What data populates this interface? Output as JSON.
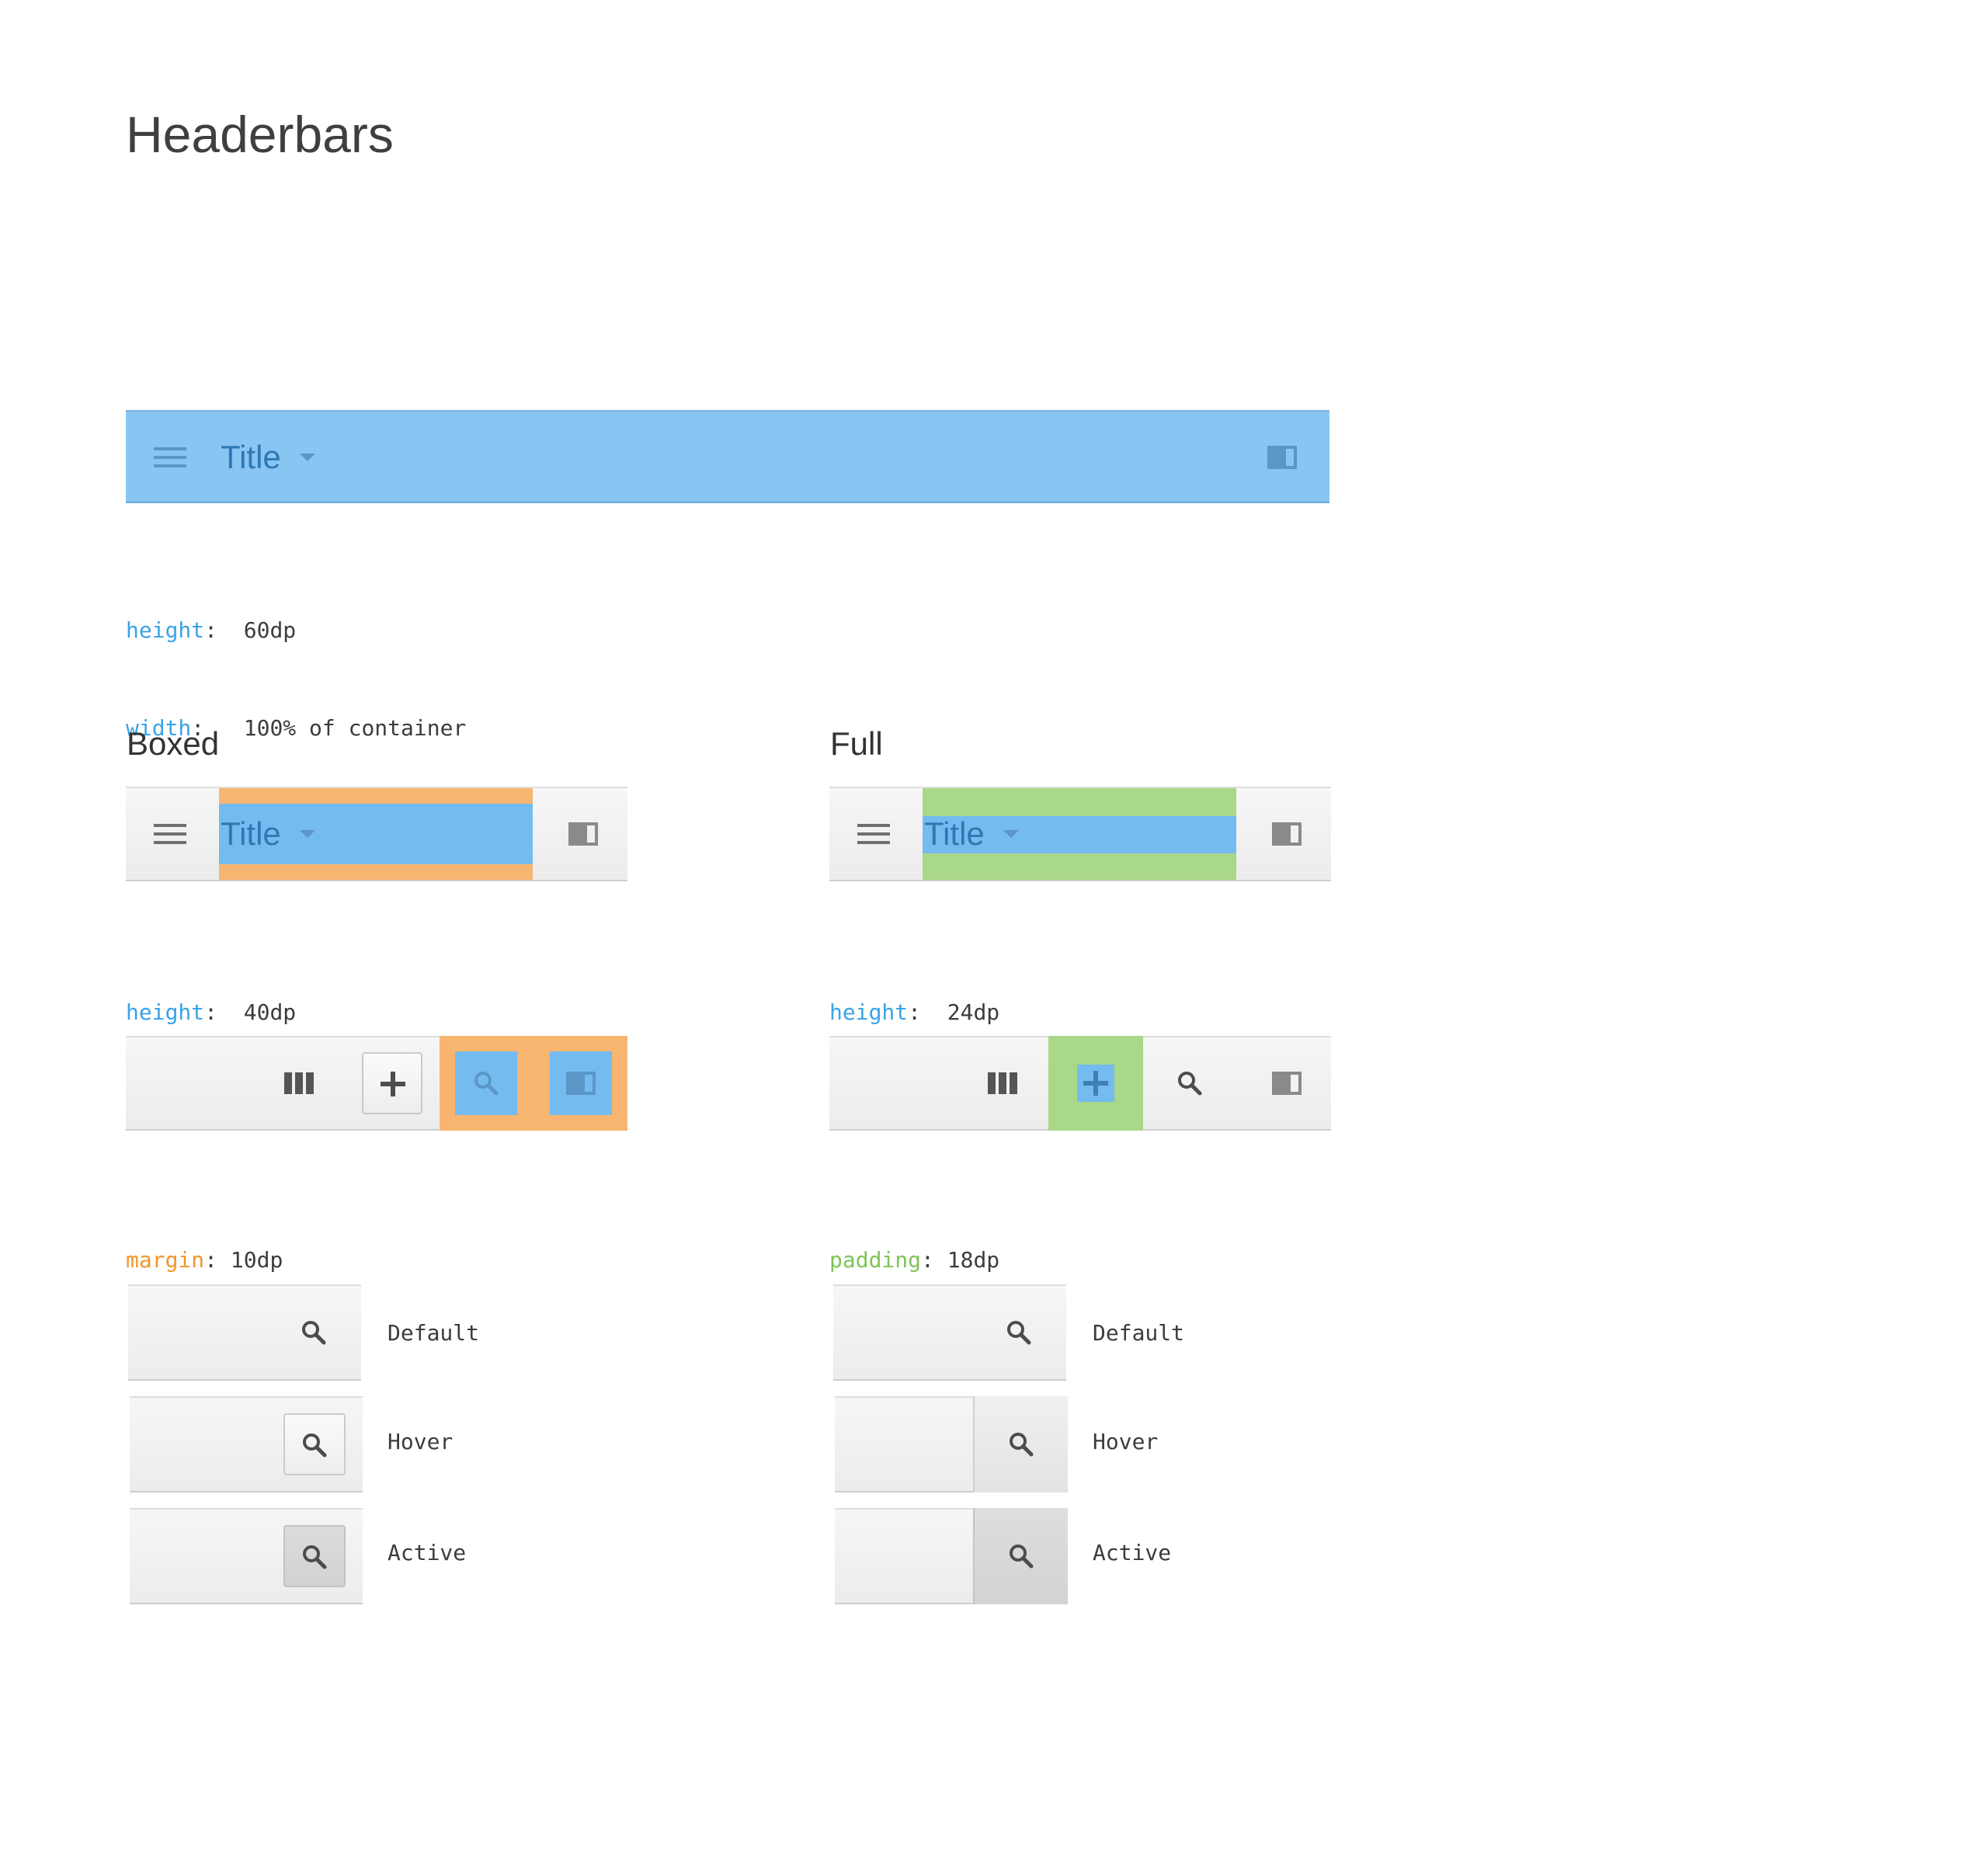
{
  "page": {
    "title": "Headerbars"
  },
  "main_bar": {
    "title": "Title",
    "specs": [
      {
        "key": "height",
        "sep": ":  ",
        "value": "60dp"
      },
      {
        "key": "width",
        "sep": ":   ",
        "value": "100% of container"
      }
    ]
  },
  "boxed": {
    "heading": "Boxed",
    "title": "Title",
    "title_specs": [
      {
        "key": "height",
        "sep": ":  ",
        "value": "40dp"
      },
      {
        "key": "margin",
        "sep": ":  ",
        "value": "10dp"
      }
    ],
    "actions_spec": {
      "key": "margin",
      "sep": ": ",
      "value": "10dp"
    },
    "states": [
      "Default",
      "Hover",
      "Active"
    ]
  },
  "full": {
    "heading": "Full",
    "title": "Title",
    "title_specs": [
      {
        "key": "height",
        "sep": ":  ",
        "value": "24dp"
      },
      {
        "key": "padding",
        "sep": ": ",
        "value": "18dp"
      }
    ],
    "actions_spec": {
      "key": "padding",
      "sep": ": ",
      "value": "18dp"
    },
    "states": [
      "Default",
      "Hover",
      "Active"
    ]
  },
  "colors": {
    "highlight_blue": "#88c5f2",
    "content_blue": "#74bbf0",
    "margin_orange": "#f7b56f",
    "padding_green": "#a9d888",
    "spec_key_blue": "#3aa2e6",
    "spec_key_orange": "#f0972b",
    "spec_key_green": "#7dc455"
  },
  "icons": [
    "menu-icon",
    "dropdown-caret-icon",
    "sidebar-toggle-icon",
    "columns-view-icon",
    "plus-icon",
    "search-icon"
  ]
}
